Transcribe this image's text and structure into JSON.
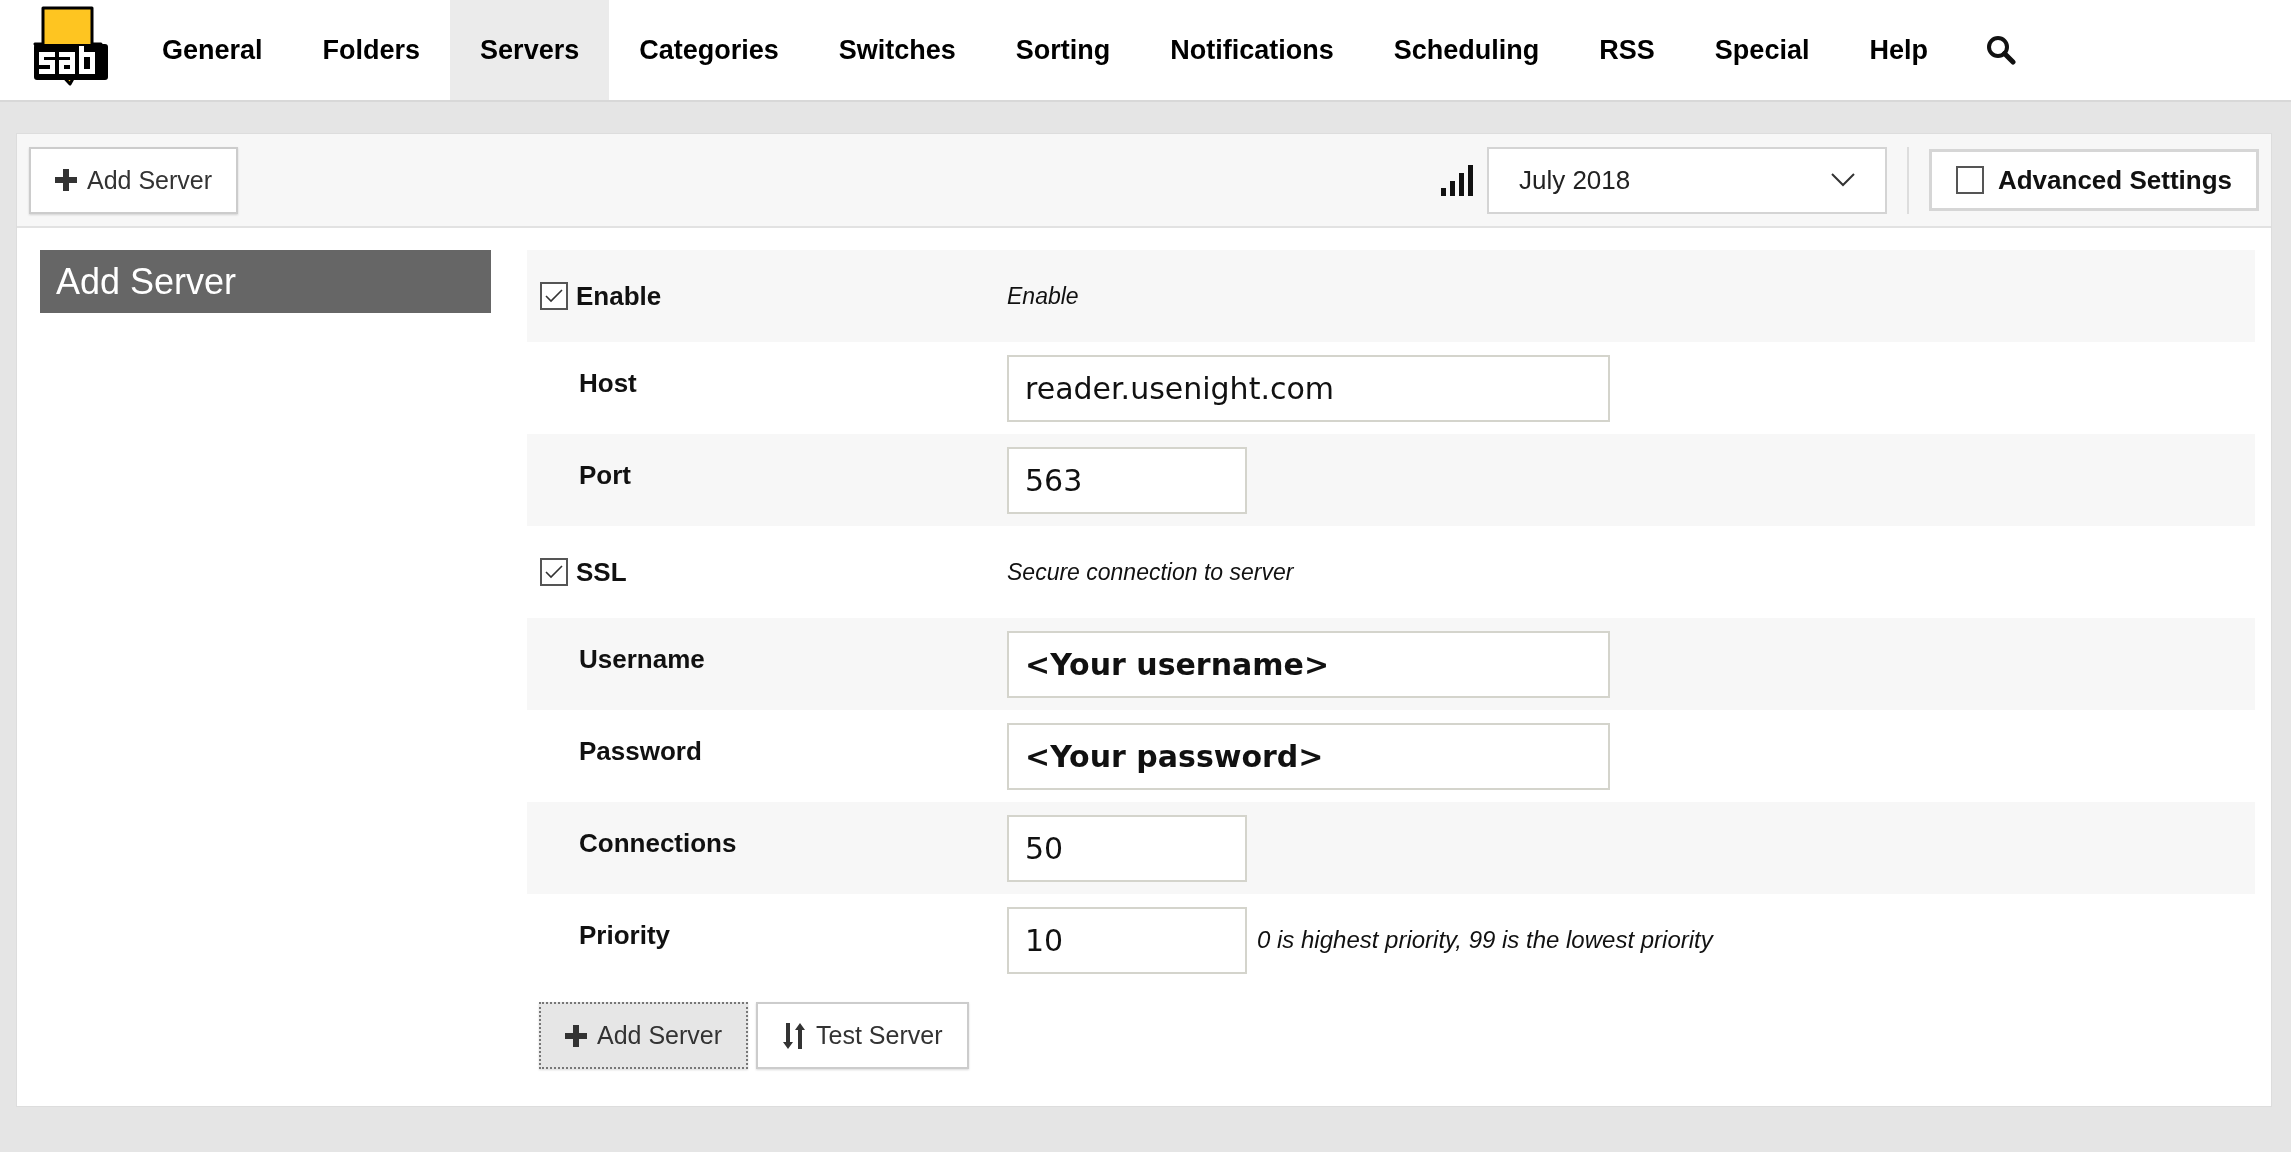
{
  "nav": {
    "items": [
      {
        "label": "General",
        "selected": false
      },
      {
        "label": "Folders",
        "selected": false
      },
      {
        "label": "Servers",
        "selected": true
      },
      {
        "label": "Categories",
        "selected": false
      },
      {
        "label": "Switches",
        "selected": false
      },
      {
        "label": "Sorting",
        "selected": false
      },
      {
        "label": "Notifications",
        "selected": false
      },
      {
        "label": "Scheduling",
        "selected": false
      },
      {
        "label": "RSS",
        "selected": false
      },
      {
        "label": "Special",
        "selected": false
      },
      {
        "label": "Help",
        "selected": false
      }
    ]
  },
  "toolbar": {
    "add_button": "Add Server",
    "version": "July 2018",
    "advanced": {
      "label": "Advanced Settings",
      "checked": false
    }
  },
  "sidebar": {
    "title": "Add Server"
  },
  "form": {
    "rows": [
      {
        "kind": "checkbox",
        "label": "Enable",
        "checked": true,
        "description": "Enable"
      },
      {
        "kind": "longfield",
        "label": "Host",
        "value": "reader.usenight.com",
        "strong": false
      },
      {
        "kind": "shortfield",
        "label": "Port",
        "value": "563",
        "strong": false
      },
      {
        "kind": "checkbox",
        "label": "SSL",
        "checked": true,
        "description": "Secure connection to server"
      },
      {
        "kind": "longfield",
        "label": "Username",
        "value": "<Your username>",
        "strong": true
      },
      {
        "kind": "longfield",
        "label": "Password",
        "value": "<Your password>",
        "strong": true
      },
      {
        "kind": "shortfield",
        "label": "Connections",
        "value": "50",
        "strong": false
      },
      {
        "kind": "shortfield",
        "label": "Priority",
        "value": "10",
        "strong": false,
        "hint": "0 is highest priority, 99 is the lowest priority"
      }
    ],
    "buttons": [
      {
        "kind": "add",
        "label": "Add Server",
        "selected": true
      },
      {
        "kind": "test",
        "label": "Test Server",
        "selected": false
      }
    ]
  }
}
